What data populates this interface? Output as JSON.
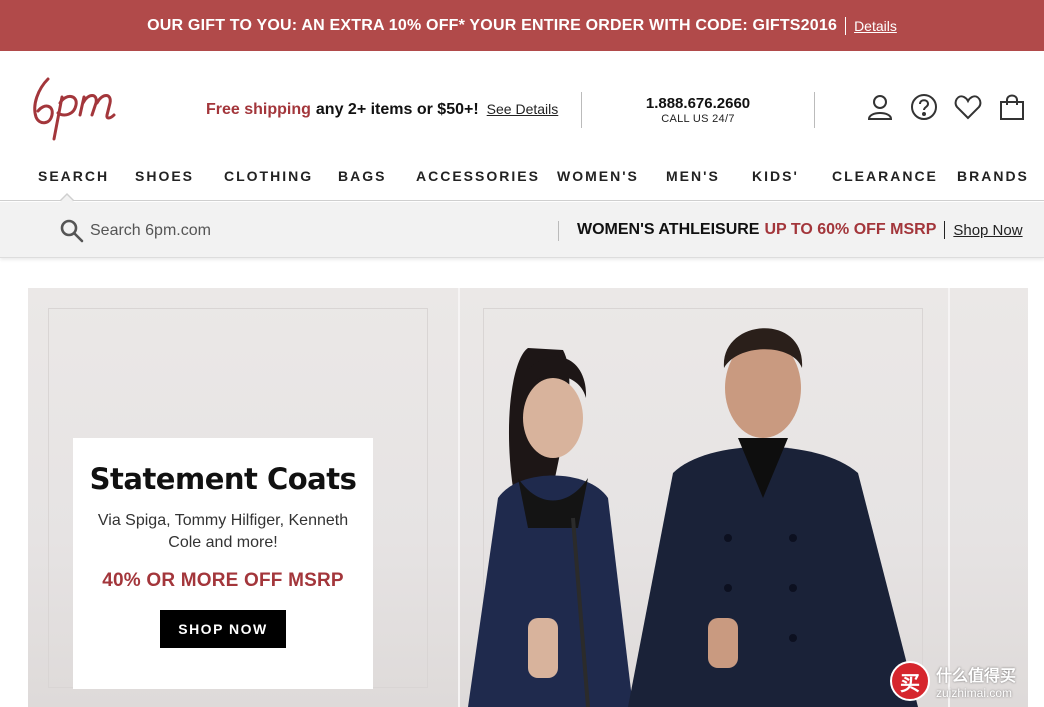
{
  "promo_bar": {
    "text": "OUR GIFT TO YOU: AN EXTRA 10% OFF* YOUR ENTIRE ORDER WITH CODE: GIFTS2016",
    "link": "Details",
    "bg_color": "#b14a4a"
  },
  "header": {
    "logo_text": "6pm",
    "shipping": {
      "highlight": "Free shipping",
      "rest": "any 2+ items or $50+!",
      "link": "See Details"
    },
    "phone": {
      "number": "1.888.676.2660",
      "subtitle": "CALL US 24/7"
    },
    "icons": [
      "account-icon",
      "help-icon",
      "favorites-heart-icon",
      "shopping-bag-icon"
    ]
  },
  "nav": {
    "items": [
      "SEARCH",
      "SHOES",
      "CLOTHING",
      "BAGS",
      "ACCESSORIES",
      "WOMEN'S",
      "MEN'S",
      "KIDS'",
      "CLEARANCE",
      "BRANDS"
    ]
  },
  "subbar": {
    "search_placeholder": "Search 6pm.com",
    "athleisure_label": "WOMEN'S ATHLEISURE",
    "athleisure_offer": "UP TO 60% OFF MSRP",
    "athleisure_link": "Shop Now"
  },
  "hero": {
    "title": "Statement Coats",
    "brands": "Via Spiga, Tommy Hilfiger, Kenneth Cole and more!",
    "offer": "40% OR MORE OFF MSRP",
    "button": "SHOP NOW"
  },
  "watermark": {
    "badge": "买",
    "name": "什么值得买",
    "url": "zuizhimai.com"
  },
  "colors": {
    "accent": "#a3363b",
    "promo_bg": "#b14a4a"
  }
}
